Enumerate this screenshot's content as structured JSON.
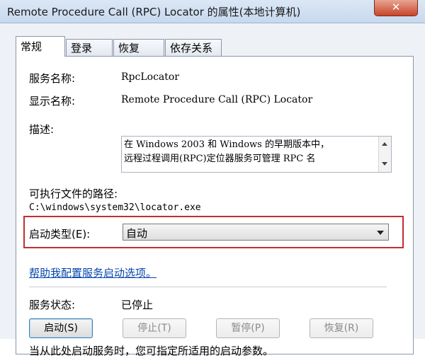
{
  "window": {
    "title": "Remote Procedure Call (RPC) Locator 的属性(本地计算机)",
    "close_glyph": "✕"
  },
  "tabs": [
    {
      "label": "常规",
      "active": true
    },
    {
      "label": "登录",
      "active": false
    },
    {
      "label": "恢复",
      "active": false
    },
    {
      "label": "依存关系",
      "active": false
    }
  ],
  "general": {
    "service_name_label": "服务名称:",
    "service_name_value": "RpcLocator",
    "display_name_label": "显示名称:",
    "display_name_value": "Remote Procedure Call (RPC) Locator",
    "description_label": "描述:",
    "description_line1": "在 Windows 2003 和 Windows 的早期版本中，",
    "description_line2": "远程过程调用(RPC)定位器服务可管理 RPC 名",
    "exe_path_label": "可执行文件的路径:",
    "exe_path_value": "C:\\windows\\system32\\locator.exe",
    "startup_type_label": "启动类型(E):",
    "startup_type_value": "自动",
    "help_link": "帮助我配置服务启动选项。",
    "status_label": "服务状态:",
    "status_value": "已停止",
    "buttons": {
      "start": "启动(S)",
      "stop": "停止(T)",
      "pause": "暂停(P)",
      "resume": "恢复(R)"
    },
    "hint": "当从此处启动服务时，您可指定所适用的启动参数。"
  },
  "colors": {
    "highlight_border": "#c0302e",
    "link": "#0645ad"
  }
}
